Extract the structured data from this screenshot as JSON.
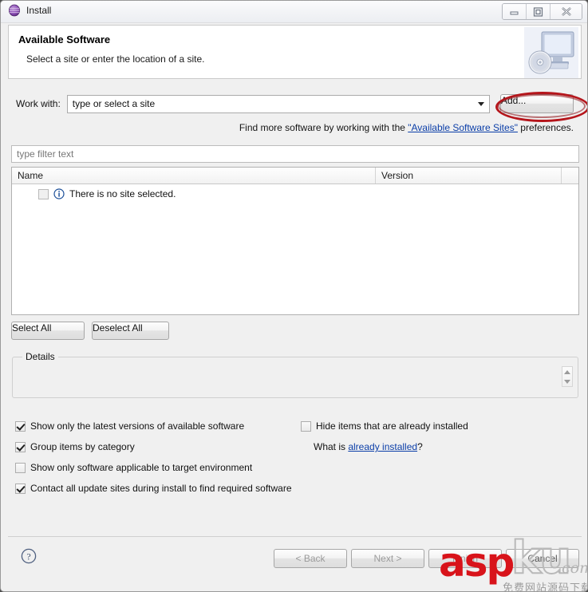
{
  "window": {
    "title": "Install",
    "app_icon": "eclipse-sphere-icon",
    "controls": [
      {
        "name": "minimize",
        "glyph": "minimize-icon"
      },
      {
        "name": "maximize",
        "glyph": "maximize-icon"
      },
      {
        "name": "close",
        "glyph": "close-icon"
      }
    ]
  },
  "header": {
    "title": "Available Software",
    "subtitle": "Select a site or enter the location of a site.",
    "icon": "monitor-with-disc-icon"
  },
  "work_with": {
    "label": "Work with:",
    "value": "type or select a site",
    "placeholder": "type or select a site",
    "dropdown_icon": "chevron-down-icon",
    "add_button": "Add...",
    "annotation_color": "#b5151b"
  },
  "find_more": {
    "prefix": "Find more software by working with the ",
    "link": "\"Available Software Sites\"",
    "suffix": " preferences."
  },
  "filter": {
    "placeholder": "type filter text",
    "value": ""
  },
  "table": {
    "columns": [
      "Name",
      "Version",
      ""
    ],
    "rows": [
      {
        "checked": false,
        "icon": "info-icon",
        "name": "There is no site selected.",
        "version": ""
      }
    ]
  },
  "selection_buttons": {
    "select_all": "Select All",
    "deselect_all": "Deselect All"
  },
  "details": {
    "legend": "Details",
    "content": "",
    "spinner_up_icon": "spinner-up-icon",
    "spinner_down_icon": "spinner-down-icon"
  },
  "options": [
    {
      "label": "Show only the latest versions of available software",
      "checked": true
    },
    {
      "label": "Group items by category",
      "checked": true
    },
    {
      "label": "Show only software applicable to target environment",
      "checked": false
    },
    {
      "label": "Contact all update sites during install to find required software",
      "checked": true
    },
    {
      "label": "Hide items that are already installed",
      "checked": false
    }
  ],
  "what_is": {
    "prefix": "What is ",
    "link": "already installed",
    "suffix": "?"
  },
  "footer": {
    "help_icon": "help-question-icon",
    "back": "< Back",
    "next": "Next >",
    "finish": "Finish",
    "cancel": "Cancel"
  },
  "watermark": {
    "part_red": "asp",
    "part_outline": "ku",
    "part_domain": ".com",
    "subtitle_cn": "免费网站源码下载站"
  }
}
